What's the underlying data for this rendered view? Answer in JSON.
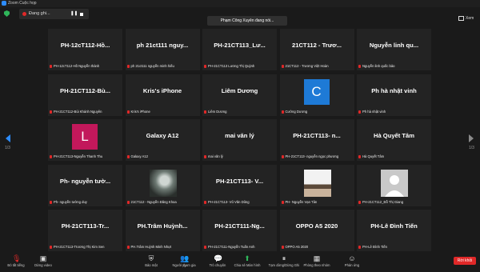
{
  "window": {
    "title": "Zoom Cuộc họp"
  },
  "top": {
    "recording": "Đang ghi...",
    "speaker": "Phạm Công Xuyên đang nói...",
    "view": "Xem"
  },
  "pager": {
    "left": "1/3",
    "right": "1/3"
  },
  "tiles": [
    {
      "name": "PH-12cT112-Hồ...",
      "label": "PH-12cT112-Hồ Nguyễn thành"
    },
    {
      "name": "ph 21ct111 nguy...",
      "label": "ph 21ct111 nguyễn minh hiếu"
    },
    {
      "name": "PH-21CT113_Lư...",
      "label": "PH-21CT113 Lương Thị Quỳnh"
    },
    {
      "name": "21CT112 - Trươ...",
      "label": "21CT112 - Trương Việt Hoàn"
    },
    {
      "name": "Nguyễn linh qu...",
      "label": "Nguyễn linh quốc bảo"
    },
    {
      "name": "PH-21CT112-Bù...",
      "label": "PH-21CT112-Bùi Khánh Nguyên"
    },
    {
      "name": "Kris's iPhone",
      "label": "Kris's iPhone"
    },
    {
      "name": "Liêm Dương",
      "label": "Liêm Dương"
    },
    {
      "name": "",
      "label": "Cường Dương",
      "avatar": "C",
      "avatar_color": "#1e7ad6"
    },
    {
      "name": "Ph hà nhật vinh",
      "label": "Ph hà nhật vinh"
    },
    {
      "name": "",
      "label": "PH-21CT113-Nguyễn Thanh Thu",
      "avatar": "L",
      "avatar_color": "#c2185b"
    },
    {
      "name": "Galaxy A12",
      "label": "Galaxy A12"
    },
    {
      "name": "mai văn lý",
      "label": "mai văn lý"
    },
    {
      "name": "PH-21CT113- n...",
      "label": "PH-21CT113- nguyễn ngọc phương"
    },
    {
      "name": "Hà Quyết Tâm",
      "label": "Hà Quyết Tâm"
    },
    {
      "name": "Ph- nguyễn tườ...",
      "label": "Ph- nguyễn tường duy"
    },
    {
      "name": "",
      "label": "21CT112 - Nguyễn Đăng Khoa",
      "photo": "dark"
    },
    {
      "name": "PH-21CT113- V...",
      "label": "PH-21CT113- Vũ Văn Dũng"
    },
    {
      "name": "",
      "label": "PH- Nguyễn Vạn Tân",
      "photo": "light"
    },
    {
      "name": "",
      "label": "PH-21CT112_Đỗ Thị Giang",
      "photo": "placeholder"
    },
    {
      "name": "PH-21CT113-Tr...",
      "label": "PH-21CT113-Trương Thị Kim Sen"
    },
    {
      "name": "PH.Trâm Huỳnh...",
      "label": "PH.Trâm Huỳnh Minh Nhựt"
    },
    {
      "name": "PH-21CT111-Ng...",
      "label": "PH-21CT111-Nguyễn Tuấn Anh"
    },
    {
      "name": "OPPO A5 2020",
      "label": "OPPO A5 2020"
    },
    {
      "name": "PH-Lê Đình Tiến",
      "label": "PH-Lê Đình Tiến"
    }
  ],
  "toolbar": {
    "unmute": "Bỏ tắt tiếng",
    "start_video": "Dừng video",
    "security": "Bảo mật",
    "participants": "Người tham gia",
    "participants_count": "71",
    "chat": "Trò chuyện",
    "share": "Chia sẻ Màn hình",
    "pause_record": "Tạm dừng/Dừng Ghi",
    "breakout": "Phòng theo nhóm",
    "reactions": "Phản ứng",
    "end": "Rời khỏi"
  },
  "colors": {
    "accent": "#2d8cff",
    "end": "#e02828",
    "share": "#2fb55a"
  }
}
